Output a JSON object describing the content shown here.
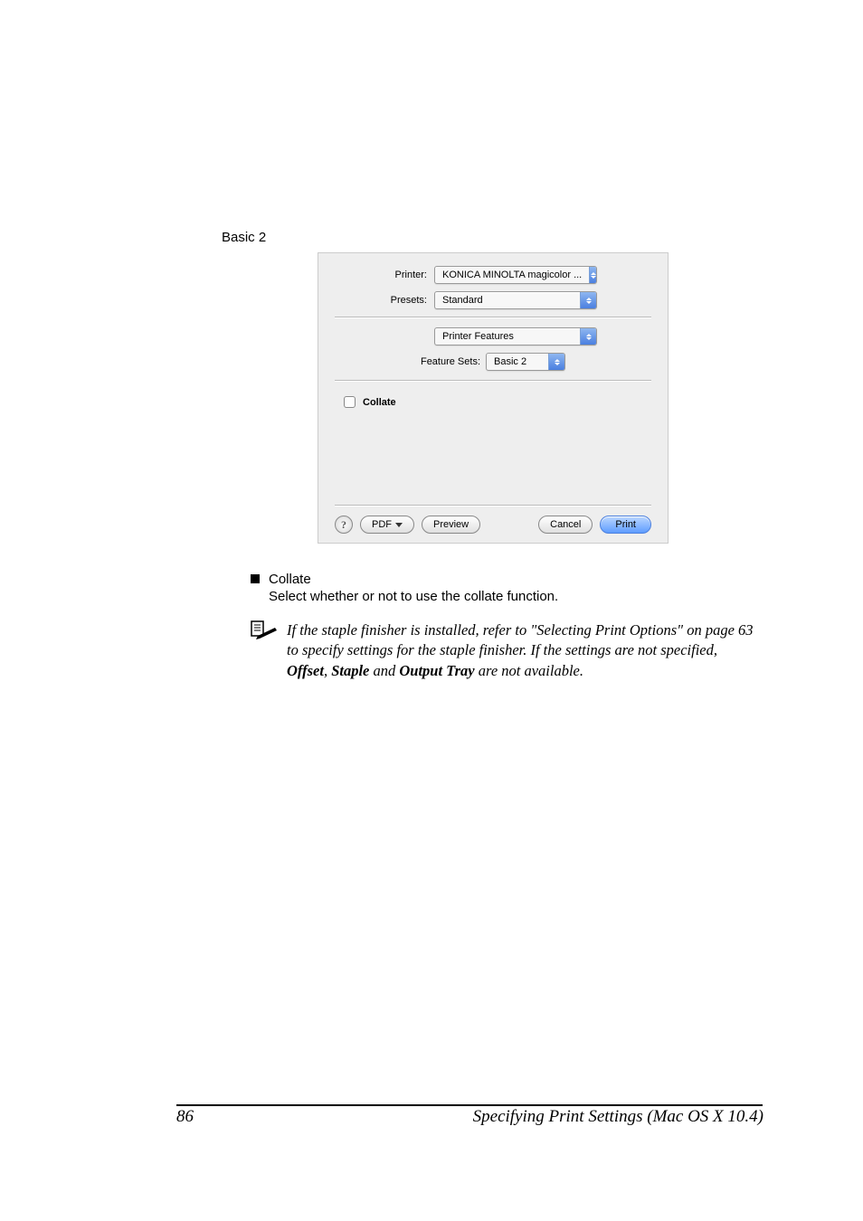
{
  "caption": "Basic 2",
  "dialog": {
    "printerLabel": "Printer:",
    "printerValue": "KONICA MINOLTA magicolor ...",
    "presetsLabel": "Presets:",
    "presetsValue": "Standard",
    "paneValue": "Printer Features",
    "featureSetsLabel": "Feature Sets:",
    "featureSetsValue": "Basic 2",
    "collateLabel": "Collate",
    "help": "?",
    "pdf": "PDF",
    "preview": "Preview",
    "cancel": "Cancel",
    "print": "Print"
  },
  "bulletTitle": "Collate",
  "bulletSub": "Select whether or not to use the collate function.",
  "note": {
    "pre": "If the staple finisher is installed, refer to \"Selecting Print Options\" on page 63 to specify settings for the staple finisher. If the settings are not specified, ",
    "offset": "Offset",
    "sep1": ", ",
    "staple": "Staple",
    "sep2": " and ",
    "output": "Output Tray",
    "post": " are not available."
  },
  "footer": {
    "pageNumber": "86",
    "title": "Specifying Print Settings (Mac OS X 10.4)"
  }
}
